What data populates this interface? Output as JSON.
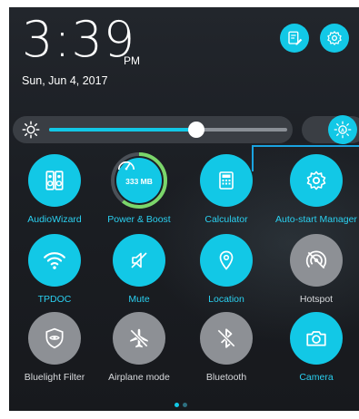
{
  "clock": {
    "time": "3:39",
    "ampm": "PM",
    "date": "Sun, Jun 4, 2017"
  },
  "top_actions": [
    {
      "icon": "edit-settings-icon"
    },
    {
      "icon": "gear-icon"
    }
  ],
  "brightness": {
    "level": 0.62,
    "auto_icon": "auto-brightness-icon"
  },
  "tiles": [
    {
      "label": "AudioWizard",
      "icon": "audiowizard-icon",
      "state": "on"
    },
    {
      "label": "Power & Boost",
      "icon": "speedometer-icon",
      "state": "on",
      "value": "333 MB"
    },
    {
      "label": "Calculator",
      "icon": "calculator-icon",
      "state": "on"
    },
    {
      "label": "Auto-start Manager",
      "icon": "gear-icon",
      "state": "on"
    },
    {
      "label": "TPDOC",
      "icon": "wifi-icon",
      "state": "on"
    },
    {
      "label": "Mute",
      "icon": "mute-icon",
      "state": "on"
    },
    {
      "label": "Location",
      "icon": "location-pin-icon",
      "state": "on"
    },
    {
      "label": "Hotspot",
      "icon": "hotspot-off-icon",
      "state": "off"
    },
    {
      "label": "Bluelight Filter",
      "icon": "eye-shield-icon",
      "state": "off"
    },
    {
      "label": "Airplane mode",
      "icon": "airplane-icon",
      "state": "off"
    },
    {
      "label": "Bluetooth",
      "icon": "bluetooth-off-icon",
      "state": "off"
    },
    {
      "label": "Camera",
      "icon": "camera-icon",
      "state": "on"
    }
  ],
  "pager": {
    "pages": 2,
    "current": 1
  },
  "colors": {
    "accent": "#12c8e6",
    "tile_off": "#8d9095",
    "panel_bg": "#1b1e23"
  }
}
